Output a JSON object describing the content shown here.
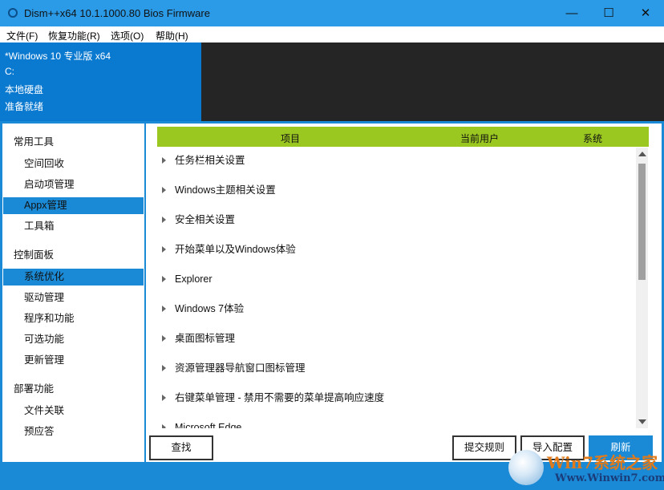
{
  "window": {
    "title": "Dism++x64 10.1.1000.80 Bios Firmware",
    "minimize": "—",
    "maximize": "☐",
    "close": "✕"
  },
  "menu": [
    "文件(F)",
    "恢复功能(R)",
    "选项(O)",
    "帮助(H)"
  ],
  "info": {
    "os": "*Windows 10 专业版 x64",
    "drive": "C:",
    "disk": "本地硬盘",
    "status": "准备就绪"
  },
  "sidebar": {
    "groups": [
      {
        "label": "常用工具",
        "items": [
          "空间回收",
          "启动项管理",
          "Appx管理",
          "工具箱"
        ]
      },
      {
        "label": "控制面板",
        "items": [
          "系统优化",
          "驱动管理",
          "程序和功能",
          "可选功能",
          "更新管理"
        ]
      },
      {
        "label": "部署功能",
        "items": [
          "文件关联",
          "预应答"
        ]
      }
    ],
    "selected": "系统优化",
    "highlighted": "Appx管理"
  },
  "table": {
    "columns": [
      "项目",
      "当前用户",
      "系统"
    ],
    "rows": [
      "任务栏相关设置",
      "Windows主题相关设置",
      "安全相关设置",
      "开始菜单以及Windows体验",
      "Explorer",
      "Windows 7体验",
      "桌面图标管理",
      "资源管理器导航窗口图标管理",
      "右键菜单管理 - 禁用不需要的菜单提高响应速度",
      "Microsoft Edge"
    ]
  },
  "buttons": {
    "find": "查找",
    "submit_rules": "提交规则",
    "import_config": "导入配置",
    "refresh": "刷新"
  },
  "watermark": {
    "brand": "Win7系统之家",
    "url": "Www.Winwin7.com"
  }
}
